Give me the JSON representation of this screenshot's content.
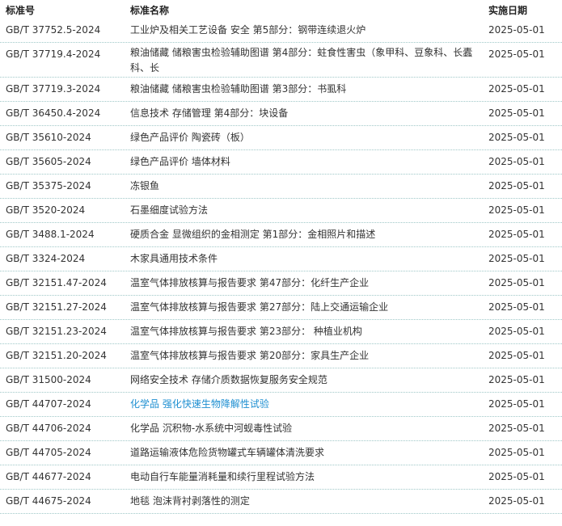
{
  "headers": {
    "code": "标准号",
    "name": "标准名称",
    "date": "实施日期"
  },
  "rows": [
    {
      "code": "GB/T 37752.5-2024",
      "name": "工业炉及相关工艺设备 安全 第5部分：钢带连续退火炉",
      "date": "2025-05-01"
    },
    {
      "code": "GB/T 37719.4-2024",
      "name": "粮油储藏 储粮害虫检验辅助图谱 第4部分：蛀食性害虫（象甲科、豆象科、长蠹科、长",
      "date": "2025-05-01"
    },
    {
      "code": "GB/T 37719.3-2024",
      "name": "粮油储藏 储粮害虫检验辅助图谱 第3部分：书虱科",
      "date": "2025-05-01"
    },
    {
      "code": "GB/T 36450.4-2024",
      "name": "信息技术 存储管理 第4部分：块设备",
      "date": "2025-05-01"
    },
    {
      "code": "GB/T 35610-2024",
      "name": "绿色产品评价 陶瓷砖（板）",
      "date": "2025-05-01"
    },
    {
      "code": "GB/T 35605-2024",
      "name": "绿色产品评价 墙体材料",
      "date": "2025-05-01"
    },
    {
      "code": "GB/T 35375-2024",
      "name": "冻银鱼",
      "date": "2025-05-01"
    },
    {
      "code": "GB/T 3520-2024",
      "name": "石墨细度试验方法",
      "date": "2025-05-01"
    },
    {
      "code": "GB/T 3488.1-2024",
      "name": "硬质合金 显微组织的金相测定 第1部分：金相照片和描述",
      "date": "2025-05-01"
    },
    {
      "code": "GB/T 3324-2024",
      "name": "木家具通用技术条件",
      "date": "2025-05-01"
    },
    {
      "code": "GB/T 32151.47-2024",
      "name": "温室气体排放核算与报告要求 第47部分：化纤生产企业",
      "date": "2025-05-01"
    },
    {
      "code": "GB/T 32151.27-2024",
      "name": "温室气体排放核算与报告要求 第27部分：陆上交通运输企业",
      "date": "2025-05-01"
    },
    {
      "code": "GB/T 32151.23-2024",
      "name": "温室气体排放核算与报告要求 第23部分： 种植业机构",
      "date": "2025-05-01"
    },
    {
      "code": "GB/T 32151.20-2024",
      "name": "温室气体排放核算与报告要求 第20部分：家具生产企业",
      "date": "2025-05-01"
    },
    {
      "code": "GB/T 31500-2024",
      "name": "网络安全技术 存储介质数据恢复服务安全规范",
      "date": "2025-05-01"
    },
    {
      "code": "GB/T 44707-2024",
      "name": "化学品 强化快速生物降解性试验",
      "date": "2025-05-01",
      "highlight": true
    },
    {
      "code": "GB/T 44706-2024",
      "name": "化学品 沉积物-水系统中河蚬毒性试验",
      "date": "2025-05-01"
    },
    {
      "code": "GB/T 44705-2024",
      "name": "道路运输液体危险货物罐式车辆罐体清洗要求",
      "date": "2025-05-01"
    },
    {
      "code": "GB/T 44677-2024",
      "name": "电动自行车能量消耗量和续行里程试验方法",
      "date": "2025-05-01"
    },
    {
      "code": "GB/T 44675-2024",
      "name": "地毯 泡沫背衬剥落性的测定",
      "date": "2025-05-01"
    }
  ],
  "colors": {
    "text": "#333333",
    "link": "#1e8fd1",
    "divider": "#9fc8c8"
  }
}
